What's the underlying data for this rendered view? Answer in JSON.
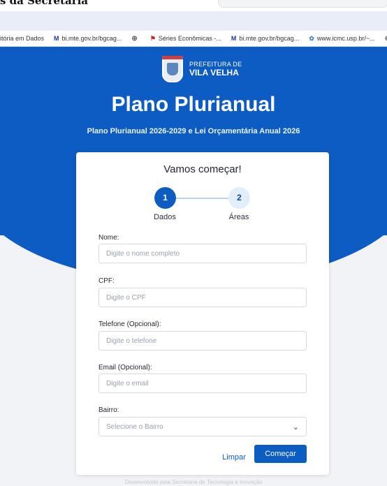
{
  "top": {
    "clipped_title": "s da Secretaria"
  },
  "bookmarks": [
    {
      "icon": "none",
      "label": "itória em Dados"
    },
    {
      "icon": "mte-icon",
      "label": "bi.mte.gov.br/bgcag..."
    },
    {
      "icon": "globe-icon",
      "label": ""
    },
    {
      "icon": "flag-icon",
      "label": "Séries Econômicas -..."
    },
    {
      "icon": "mte-icon",
      "label": "bi.mte.gov.br/bgcag..."
    },
    {
      "icon": "usp-icon",
      "label": "www.icmc.usp.br/~..."
    },
    {
      "icon": "globe-icon",
      "label": "Co"
    }
  ],
  "logo": {
    "line1": "PREFEITURA DE",
    "line2": "VILA VELHA"
  },
  "header": {
    "title": "Plano Plurianual",
    "subtitle": "Plano Plurianual 2026-2029 e Lei Orçamentária Anual 2026"
  },
  "card": {
    "title": "Vamos começar!",
    "steps": [
      {
        "number": "1",
        "label": "Dados"
      },
      {
        "number": "2",
        "label": "Áreas"
      }
    ],
    "fields": {
      "nome": {
        "label": "Nome:",
        "placeholder": "Digite o nome completo",
        "value": ""
      },
      "cpf": {
        "label": "CPF:",
        "placeholder": "Digite o CPF",
        "value": ""
      },
      "telefone": {
        "label": "Telefone (Opcional):",
        "placeholder": "Digite o telefone",
        "value": ""
      },
      "email": {
        "label": "Email (Opcional):",
        "placeholder": "Digite o email",
        "value": ""
      },
      "bairro": {
        "label": "Bairro:",
        "placeholder": "Selecione o Bairro"
      }
    },
    "buttons": {
      "clear": "Limpar",
      "start": "Começar"
    }
  },
  "footer": {
    "text": "Desenvolvido pela Secretaria de Tecnologia e Inovação"
  },
  "colors": {
    "primary": "#0c5cc4",
    "background": "#f1f3f6",
    "step_inactive": "#e3eefb"
  }
}
